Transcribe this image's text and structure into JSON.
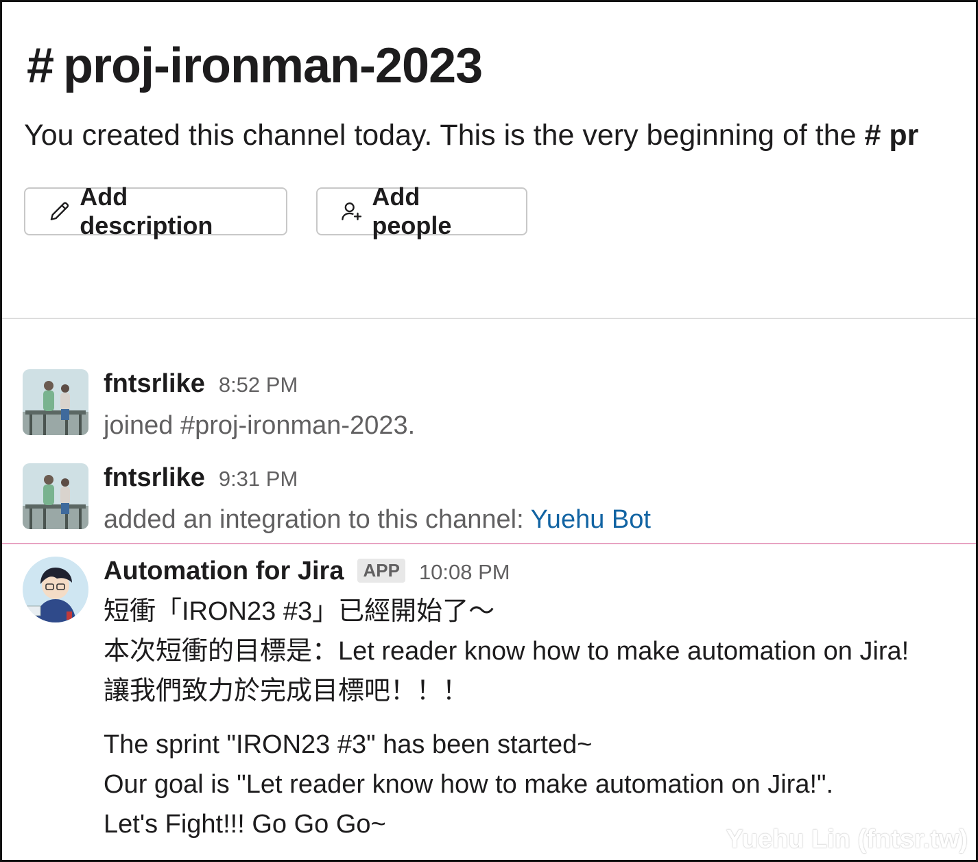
{
  "header": {
    "hash": "#",
    "channel_name": "proj-ironman-2023",
    "intro_text": "You created this channel today. This is the very beginning of the",
    "intro_channel_ref": "# pr",
    "buttons": {
      "add_description": "Add description",
      "add_people": "Add people"
    }
  },
  "messages": [
    {
      "author": "fntsrlike",
      "time": "8:52 PM",
      "text": "joined #proj-ironman-2023."
    },
    {
      "author": "fntsrlike",
      "time": "9:31 PM",
      "text": "added an integration to this channel:",
      "link": "Yuehu Bot"
    },
    {
      "author": "Automation for Jira",
      "badge": "APP",
      "time": "10:08 PM",
      "lines_zh": [
        "短衝「IRON23 #3」已經開始了～",
        "本次短衝的目標是：Let reader know how to make automation on Jira!",
        "讓我們致力於完成目標吧！！！"
      ],
      "lines_en": [
        "The sprint \"IRON23 #3\" has been started~",
        "Our goal is \"Let reader know how to make automation on Jira!\".",
        "Let's Fight!!! Go Go Go~"
      ]
    }
  ],
  "watermark": "Yuehu Lin (fntsr.tw)",
  "icons": {
    "pencil": "pencil-icon",
    "add_person": "add-person-icon"
  },
  "colors": {
    "link": "#1264a3",
    "new_message_line": "#e8a3c2",
    "muted": "#616061"
  }
}
